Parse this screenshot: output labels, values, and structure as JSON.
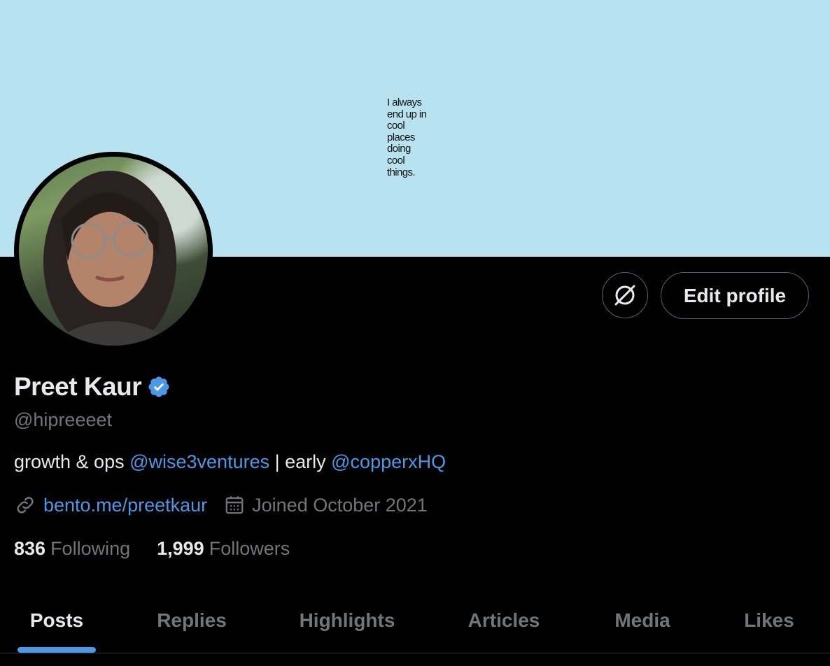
{
  "banner": {
    "text": "I always\nend up in\ncool\nplaces\ndoing\ncool\nthings."
  },
  "actions": {
    "edit_profile_label": "Edit profile",
    "icon": "no-wallet-icon"
  },
  "profile": {
    "display_name": "Preet Kaur",
    "handle": "@hipreeeet",
    "verified": true,
    "bio": {
      "part1": "growth & ops ",
      "mention1": "@wise3ventures",
      "part2": " | early ",
      "mention2": "@copperxHQ"
    },
    "website": "bento.me/preetkaur",
    "joined": "Joined October 2021"
  },
  "stats": {
    "following_count": "836",
    "following_label": "Following",
    "followers_count": "1,999",
    "followers_label": "Followers"
  },
  "tabs": [
    {
      "label": "Posts",
      "active": true
    },
    {
      "label": "Replies",
      "active": false
    },
    {
      "label": "Highlights",
      "active": false
    },
    {
      "label": "Articles",
      "active": false
    },
    {
      "label": "Media",
      "active": false
    },
    {
      "label": "Likes",
      "active": false
    }
  ],
  "colors": {
    "background": "#000000",
    "banner": "#b8e2ef",
    "accent": "#4a99e9",
    "secondary_text": "#71767b",
    "primary_text": "#e7e9ea"
  }
}
